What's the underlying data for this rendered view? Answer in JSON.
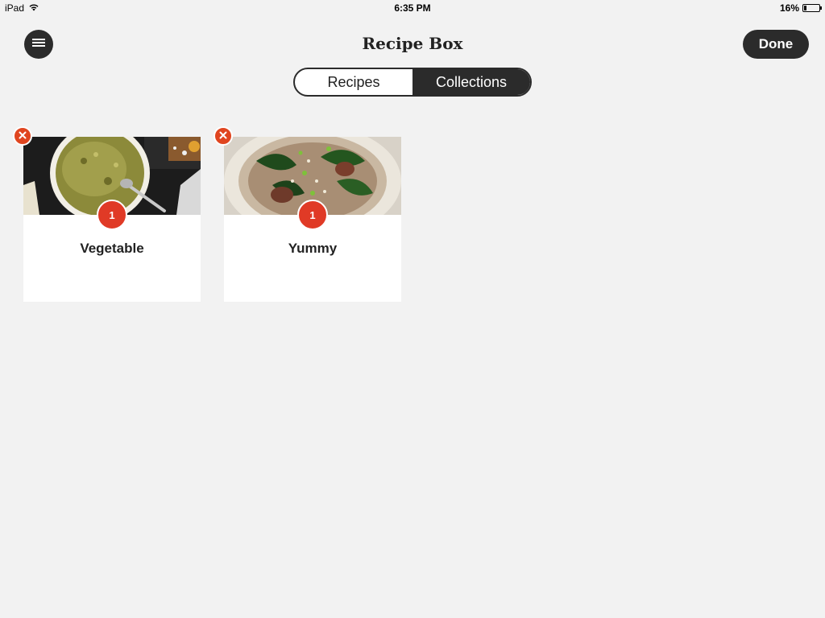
{
  "status_bar": {
    "device": "iPad",
    "time": "6:35 PM",
    "battery": "16%",
    "battery_level": 0.16
  },
  "header": {
    "title": "Recipe Box",
    "done_label": "Done",
    "menu_icon": "hamburger-icon"
  },
  "segmented": {
    "options": [
      "Recipes",
      "Collections"
    ],
    "selected": "Collections"
  },
  "collections": [
    {
      "title": "Vegetable",
      "count": "1",
      "image": "soup-bowl"
    },
    {
      "title": "Yummy",
      "count": "1",
      "image": "greens-beans-plate"
    }
  ],
  "colors": {
    "dark": "#2b2b2b",
    "badge_red": "#e03a26",
    "delete_orange": "#e0451f",
    "background": "#f2f2f2"
  }
}
